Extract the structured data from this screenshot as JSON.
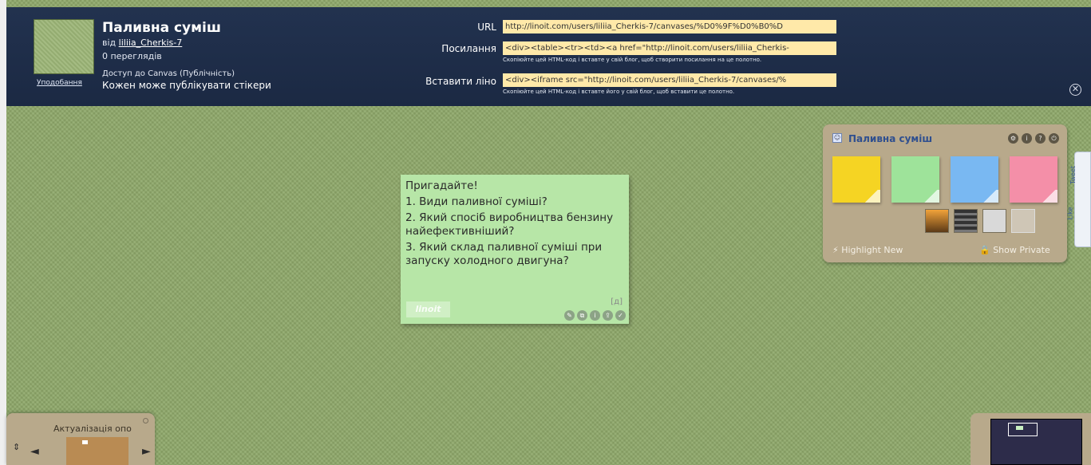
{
  "header": {
    "title": "Паливна суміш",
    "by_prefix": "від",
    "author": "liliia_Cherkis-7",
    "views": "0 переглядів",
    "favorites_link": "Уподобання",
    "access": "Доступ до Canvas (Публічність)",
    "post_permission": "Кожен може публікувати стікери",
    "fields": [
      {
        "label": "URL",
        "value": "http://linoit.com/users/liliia_Cherkis-7/canvases/%D0%9F%D0%B0%D",
        "hint": ""
      },
      {
        "label": "Посилання",
        "value": "<div><table><tr><td><a href=\"http://linoit.com/users/liliia_Cherkis-",
        "hint": "Скопіюйте цей HTML-код і вставте у свій блог, щоб створити посилання на це полотно."
      },
      {
        "label": "Вставити ліно",
        "value": "<div><iframe src=\"http://linoit.com/users/liliia_Cherkis-7/canvases/%",
        "hint": "Скопіюйте цей HTML-код і вставте його у свій блог, щоб вставити це полотно."
      }
    ],
    "close_glyph": "✕"
  },
  "sticky": {
    "color": "#b7e6a7",
    "lines": [
      "Пригадайте!",
      "1. Види паливної суміші?",
      "2. Який спосіб виробництва бензину найефективніший?",
      "3. Який склад паливної суміші при запуску холодного двигуна?"
    ],
    "mark": "[д]",
    "watermark": "linoit"
  },
  "palette": {
    "title": "Паливна суміш",
    "swatch_colors": [
      "#f5d423",
      "#9ee39a",
      "#79b8f2",
      "#f48fa8"
    ],
    "highlight_label": "Highlight New",
    "private_label": "Show Private"
  },
  "sidetab": {
    "tweet": "Tweet",
    "like": "Like"
  },
  "nav": {
    "title": "Актуалізація опо",
    "left_arrow": "◄",
    "right_arrow": "►"
  }
}
